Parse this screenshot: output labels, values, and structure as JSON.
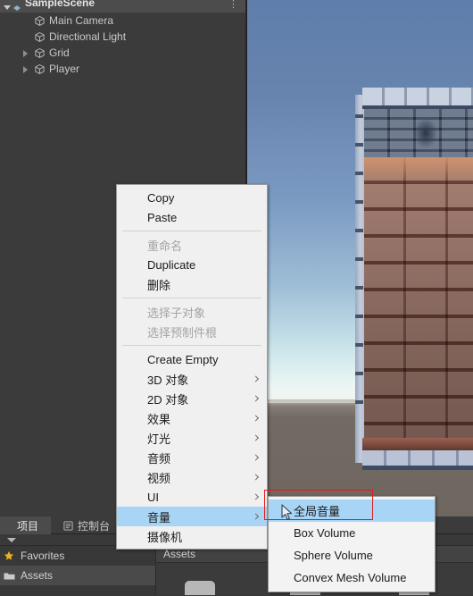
{
  "hierarchy": {
    "scene_name": "SampleScene",
    "menu_icon": "kebab-menu-icon",
    "items": [
      {
        "label": "Main Camera",
        "icon": "gameobject-cube-icon",
        "expandable": false,
        "depth": 1
      },
      {
        "label": "Directional Light",
        "icon": "gameobject-cube-icon",
        "expandable": false,
        "depth": 1
      },
      {
        "label": "Grid",
        "icon": "gameobject-cube-icon",
        "expandable": true,
        "depth": 1
      },
      {
        "label": "Player",
        "icon": "gameobject-cube-icon",
        "expandable": true,
        "depth": 1
      }
    ]
  },
  "context_menu": {
    "items": [
      {
        "label": "Copy",
        "disabled": false,
        "submenu": false,
        "separator_after": false
      },
      {
        "label": "Paste",
        "disabled": false,
        "submenu": false,
        "separator_after": true
      },
      {
        "label": "重命名",
        "disabled": true,
        "submenu": false,
        "separator_after": false
      },
      {
        "label": "Duplicate",
        "disabled": false,
        "submenu": false,
        "separator_after": false
      },
      {
        "label": "删除",
        "disabled": false,
        "submenu": false,
        "separator_after": true
      },
      {
        "label": "选择子对象",
        "disabled": true,
        "submenu": false,
        "separator_after": false
      },
      {
        "label": "选择预制件根",
        "disabled": true,
        "submenu": false,
        "separator_after": true
      },
      {
        "label": "Create Empty",
        "disabled": false,
        "submenu": false,
        "separator_after": false
      },
      {
        "label": "3D 对象",
        "disabled": false,
        "submenu": true,
        "separator_after": false
      },
      {
        "label": "2D 对象",
        "disabled": false,
        "submenu": true,
        "separator_after": false
      },
      {
        "label": "效果",
        "disabled": false,
        "submenu": true,
        "separator_after": false
      },
      {
        "label": "灯光",
        "disabled": false,
        "submenu": true,
        "separator_after": false
      },
      {
        "label": "音频",
        "disabled": false,
        "submenu": true,
        "separator_after": false
      },
      {
        "label": "视频",
        "disabled": false,
        "submenu": true,
        "separator_after": false
      },
      {
        "label": "UI",
        "disabled": false,
        "submenu": true,
        "separator_after": false
      },
      {
        "label": "音量",
        "disabled": false,
        "submenu": true,
        "separator_after": false,
        "highlighted": true
      },
      {
        "label": "摄像机",
        "disabled": false,
        "submenu": false,
        "separator_after": false
      }
    ]
  },
  "submenu": {
    "parent": "音量",
    "items": [
      {
        "label": "全局音量",
        "highlighted": true
      },
      {
        "label": "Box Volume",
        "highlighted": false
      },
      {
        "label": "Sphere Volume",
        "highlighted": false
      },
      {
        "label": "Convex Mesh Volume",
        "highlighted": false
      }
    ]
  },
  "project_panel": {
    "tabs": [
      {
        "label": "项目",
        "icon": "project-icon",
        "active": true
      },
      {
        "label": "控制台",
        "icon": "console-icon",
        "active": false
      }
    ],
    "tree": [
      {
        "label": "Favorites",
        "icon": "star-icon",
        "selected": false
      },
      {
        "label": "Assets",
        "icon": "folder-icon",
        "selected": true
      }
    ],
    "content_header": "Assets"
  },
  "annotation": {
    "highlight_color": "#e01b1b",
    "cursor": "arrow-cursor"
  },
  "colors": {
    "editor_bg": "#383838",
    "panel_bg": "#3b3b3b",
    "menu_bg": "#f0f0f0",
    "menu_highlight": "#a8d4f5",
    "text_light": "#c9c9c9",
    "annotation_red": "#e01b1b"
  }
}
